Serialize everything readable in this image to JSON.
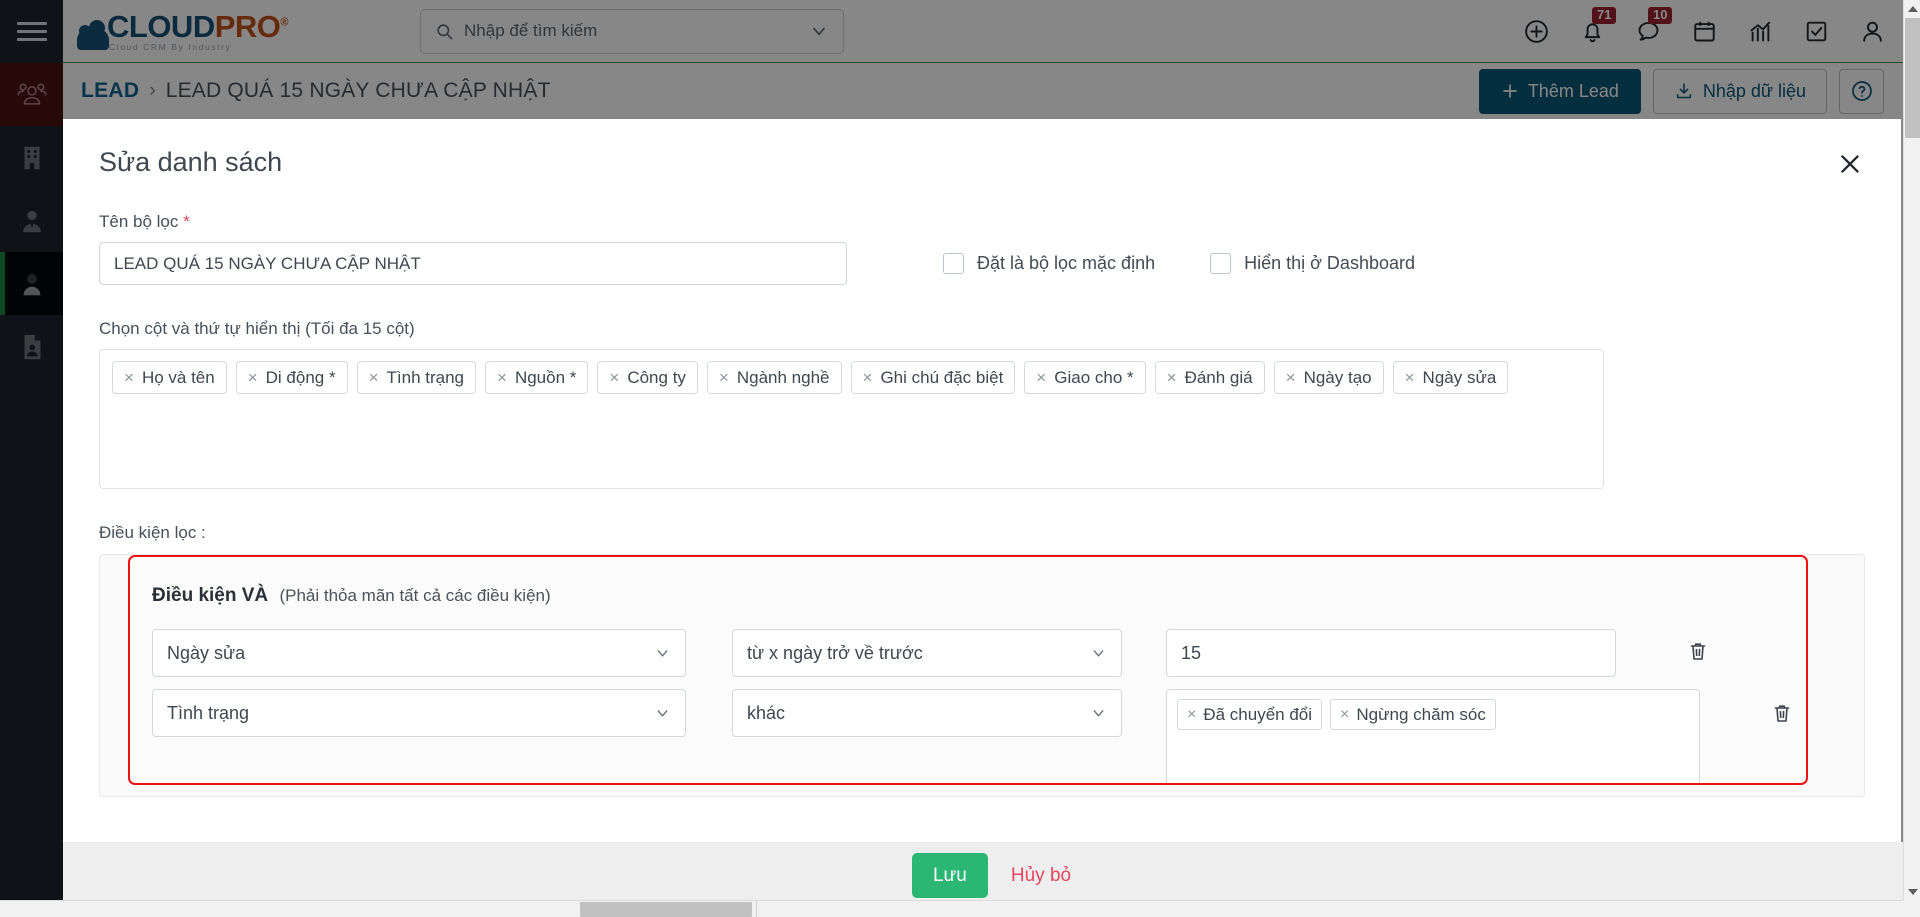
{
  "sidebar": {
    "menu_toggle": "menu-toggle",
    "items": [
      {
        "name": "group-icon",
        "state": "highlighted"
      },
      {
        "name": "building-icon",
        "state": "normal"
      },
      {
        "name": "person-tie-icon",
        "state": "normal"
      },
      {
        "name": "person-icon",
        "state": "active"
      },
      {
        "name": "document-person-icon",
        "state": "normal"
      }
    ]
  },
  "header": {
    "logo": {
      "main_cloud": "CLOUD",
      "main_pro": "PRO",
      "registered": "®",
      "tagline": "Cloud CRM By Industry"
    },
    "search": {
      "placeholder": "Nhập để tìm kiếm",
      "value": ""
    },
    "icons": [
      {
        "name": "add-circle-icon",
        "badge": ""
      },
      {
        "name": "bell-icon",
        "badge": "71"
      },
      {
        "name": "chat-icon",
        "badge": "10"
      },
      {
        "name": "calendar-icon",
        "badge": ""
      },
      {
        "name": "chart-icon",
        "badge": ""
      },
      {
        "name": "task-check-icon",
        "badge": ""
      },
      {
        "name": "user-icon",
        "badge": ""
      }
    ]
  },
  "breadcrumb": {
    "root": "LEAD",
    "separator": "›",
    "current": "LEAD QUÁ 15 NGÀY CHƯA CẬP NHẬT",
    "add_lead": "Thêm Lead",
    "import": "Nhập dữ liệu",
    "help": "?"
  },
  "modal": {
    "title": "Sửa danh sách",
    "close": "✕",
    "filter_name_label": "Tên bộ lọc",
    "required_mark": "*",
    "filter_name_value": "LEAD QUÁ 15 NGÀY CHƯA CẬP NHẬT",
    "checkbox_default": "Đặt là bộ lọc mặc định",
    "checkbox_dashboard": "Hiển thị ở Dashboard",
    "columns_label": "Chọn cột và thứ tự hiển thị (Tối đa 15 cột)",
    "column_tags": [
      "Họ và tên",
      "Di động *",
      "Tình trạng",
      "Nguồn *",
      "Công ty",
      "Ngành nghề",
      "Ghi chú đặc biệt",
      "Giao cho *",
      "Đánh giá",
      "Ngày tạo",
      "Ngày sửa"
    ],
    "tag_remove": "×",
    "conditions_label": "Điều kiện lọc :",
    "and_title": "Điều kiện VÀ",
    "and_hint": "(Phải thỏa mãn tất cả các điều kiện)",
    "rows": [
      {
        "field": "Ngày sửa",
        "operator": "từ x ngày trở về trước",
        "value_type": "text",
        "value": "15",
        "delete": "delete-condition"
      },
      {
        "field": "Tình trạng",
        "operator": "khác",
        "value_type": "tags",
        "value_tags": [
          "Đã chuyển đổi",
          "Ngừng chăm sóc"
        ],
        "delete": "delete-condition"
      }
    ]
  },
  "footer": {
    "save": "Lưu",
    "cancel": "Hủy bỏ"
  },
  "colors": {
    "brand_blue": "#1a5276",
    "brand_orange": "#c0521a",
    "primary_btn": "#0b5777",
    "save_green": "#2bb673",
    "cancel_red": "#e8475f",
    "badge_red": "#9b2232",
    "highlight_red_border": "#ee1111",
    "sidebar_bg": "#1d242e",
    "sidebar_highlight": "#4c1111",
    "accent_green": "#1a8a4a"
  }
}
